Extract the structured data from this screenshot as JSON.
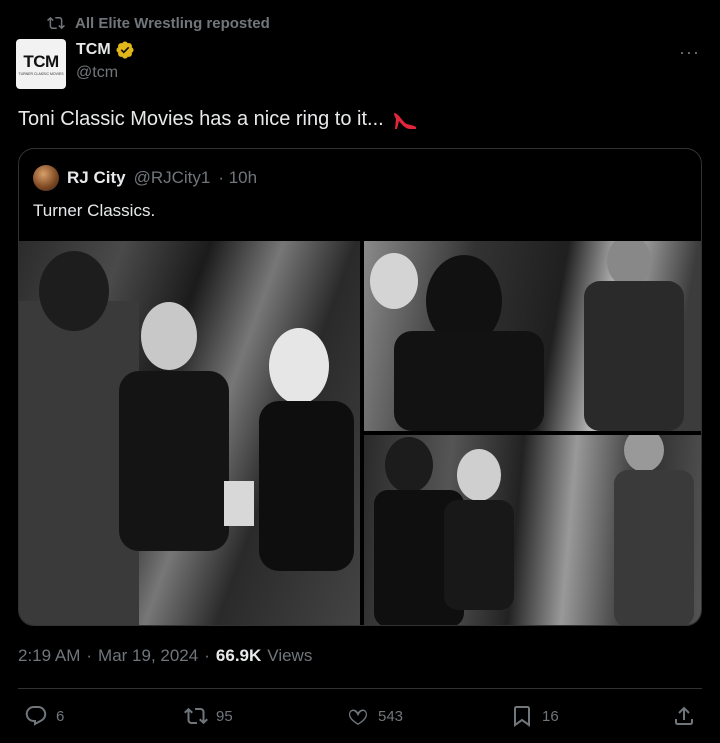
{
  "repost_header": {
    "text": "All Elite Wrestling reposted",
    "icon": "repost-icon"
  },
  "author": {
    "avatar_text": "TCM",
    "avatar_subtext": "TURNER CLASSIC MOVIES",
    "name": "TCM",
    "handle": "@tcm",
    "verified_color": "#e2b719"
  },
  "post": {
    "text": "Toni Classic Movies has a nice ring to it...",
    "emoji_icon": "high-heel-icon"
  },
  "quoted": {
    "name": "RJ City",
    "handle": "@RJCity1",
    "time": "· 10h",
    "text": "Turner Classics.",
    "photos": [
      "photo-backstage-group",
      "photo-handshake",
      "photo-makeup-chairs"
    ]
  },
  "meta": {
    "time": "2:19 AM",
    "dot1": "·",
    "date": "Mar 19, 2024",
    "dot2": "·",
    "views_count": "66.9K",
    "views_label": "Views"
  },
  "actions": {
    "replies": "6",
    "reposts": "95",
    "likes": "543",
    "bookmarks": "16"
  },
  "colors": {
    "background": "#000000",
    "text": "#e7e9ea",
    "muted": "#71767b",
    "border": "#2f3336"
  }
}
